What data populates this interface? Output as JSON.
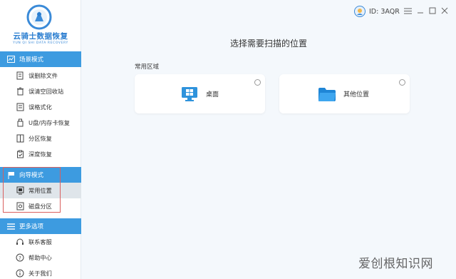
{
  "logo": {
    "title": "云骑士数据恢复",
    "subtitle": "YUN QI SHI DATA RECOVERY"
  },
  "sidebar": {
    "sections": [
      {
        "label": "场景模式",
        "icon": "scene-mode-icon",
        "items": [
          {
            "label": "误删除文件",
            "icon": "deleted-file-icon"
          },
          {
            "label": "误清空回收站",
            "icon": "recycle-bin-icon"
          },
          {
            "label": "误格式化",
            "icon": "format-icon"
          },
          {
            "label": "U盘/内存卡恢复",
            "icon": "usb-card-icon"
          },
          {
            "label": "分区恢复",
            "icon": "partition-icon"
          },
          {
            "label": "深度恢复",
            "icon": "deep-recovery-icon"
          }
        ]
      },
      {
        "label": "向导模式",
        "icon": "wizard-flag-icon",
        "items": [
          {
            "label": "常用位置",
            "icon": "common-location-icon",
            "active": true
          },
          {
            "label": "磁盘分区",
            "icon": "disk-partition-icon"
          }
        ]
      },
      {
        "label": "更多选项",
        "icon": "menu-lines-icon",
        "items": [
          {
            "label": "联系客服",
            "icon": "headset-icon"
          },
          {
            "label": "帮助中心",
            "icon": "help-icon"
          },
          {
            "label": "关于我们",
            "icon": "about-icon"
          }
        ]
      }
    ]
  },
  "topbar": {
    "user_id": "ID: 3AQR"
  },
  "main": {
    "title": "选择需要扫描的位置",
    "area_label": "常用区域",
    "cards": [
      {
        "label": "桌面",
        "icon": "desktop-icon"
      },
      {
        "label": "其他位置",
        "icon": "folder-icon"
      }
    ]
  },
  "watermark": "爱创根知识网",
  "colors": {
    "accent": "#3d9be0",
    "logo_blue": "#2b7ed0",
    "frame_red": "#d9605f",
    "background": "#f4f8fc"
  }
}
